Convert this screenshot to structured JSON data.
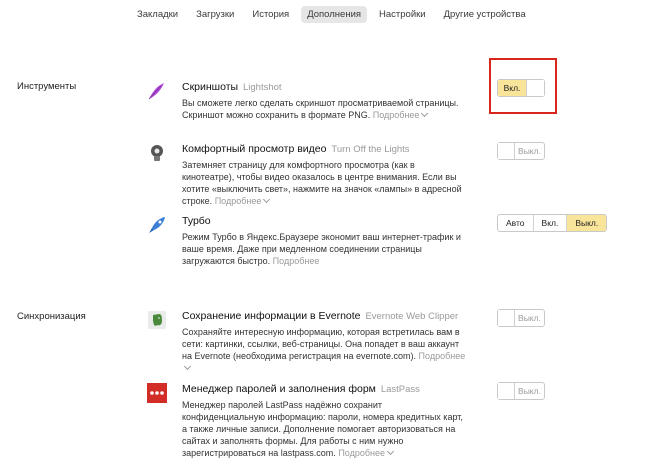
{
  "nav": {
    "tabs": [
      {
        "label": "Закладки"
      },
      {
        "label": "Загрузки"
      },
      {
        "label": "История"
      },
      {
        "label": "Дополнения"
      },
      {
        "label": "Настройки"
      },
      {
        "label": "Другие устройства"
      }
    ],
    "active": "Дополнения"
  },
  "sections": {
    "tools": "Инструменты",
    "sync": "Синхронизация"
  },
  "more_label": "Подробнее",
  "items": [
    {
      "title": "Скриншоты",
      "subtitle": "Lightshot",
      "description": "Вы сможете легко сделать скриншот просматриваемой страницы. Скриншот можно сохранить в формате PNG.",
      "toggle_label": "Вкл.",
      "enabled": true,
      "icon": "feather-icon"
    },
    {
      "title": "Комфортный просмотр видео",
      "subtitle": "Turn Off the Lights",
      "description": "Затемняет страницу для комфортного просмотра (как в кинотеатре), чтобы видео оказалось в центре внимания. Если вы хотите «выключить свет», нажмите на значок «лампы» в адресной строке.",
      "toggle_label": "Выкл.",
      "enabled": false,
      "icon": "lamp-icon"
    },
    {
      "title": "Турбо",
      "subtitle": "",
      "description": "Режим Турбо в Яндекс.Браузере экономит ваш интернет-трафик и ваше время. Даже при медленном соединении страницы загружаются быстро.",
      "options": [
        "Авто",
        "Вкл.",
        "Выкл."
      ],
      "selected": "Выкл.",
      "icon": "rocket-icon"
    },
    {
      "title": "Сохранение информации в Evernote",
      "subtitle": "Evernote Web Clipper",
      "description": "Сохраняйте интересную информацию, которая встретилась вам в сети: картинки, ссылки, веб-страницы. Она попадет в ваш аккаунт на Evernote (необходима регистрация на evernote.com).",
      "toggle_label": "Выкл.",
      "enabled": false,
      "icon": "evernote-elephant-icon"
    },
    {
      "title": "Менеджер паролей и заполнения форм",
      "subtitle": "LastPass",
      "description": "Менеджер паролей LastPass надёжно сохранит конфиденциальную информацию: пароли, номера кредитных карт, а также личные записи. Дополнение помогает авторизоваться на сайтах и заполнять формы. Для работы с ним нужно зарегистрироваться на lastpass.com.",
      "toggle_label": "Выкл.",
      "enabled": false,
      "icon": "lastpass-dots-icon"
    }
  ],
  "colors": {
    "toggle_on": "#f9e59a",
    "highlight": "#d9261c",
    "lastpass": "#d32d27"
  }
}
